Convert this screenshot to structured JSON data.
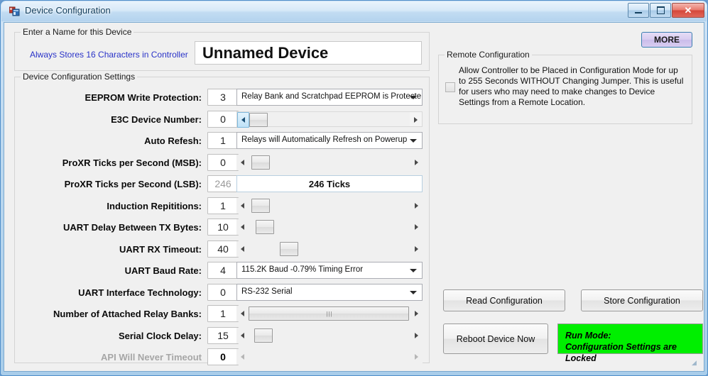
{
  "window": {
    "title": "Device Configuration",
    "icon": "app-icon",
    "buttons": {
      "minimize": "minimize-icon",
      "maximize": "maximize-icon",
      "close": "✕"
    }
  },
  "more_button": {
    "label": "MORE"
  },
  "device_name_group": {
    "title": "Enter a Name for this Device",
    "hint": "Always Stores 16 Characters in Controller",
    "value": "Unnamed Device"
  },
  "settings_group": {
    "title": "Device Configuration Settings",
    "rows": [
      {
        "label": "EEPROM Write Protection:",
        "value": "3",
        "control": "combo",
        "text": "Relay Bank and Scratchpad EEPROM is Protecte",
        "disabled": false
      },
      {
        "label": "E3C Device Number:",
        "value": "0",
        "control": "scroll",
        "thumb_pct": 0,
        "thumb_w": 26,
        "boxed": true,
        "disabled": false
      },
      {
        "label": "Auto Refesh:",
        "value": "1",
        "control": "combo",
        "text": "Relays will Automatically Refresh on Powerup",
        "disabled": false
      },
      {
        "label": "ProXR Ticks per Second (MSB):",
        "value": "0",
        "control": "scroll",
        "thumb_pct": 2,
        "thumb_w": 26,
        "boxed": false,
        "disabled": false
      },
      {
        "label": "ProXR Ticks per Second (LSB):",
        "value": "246",
        "control": "tickbox",
        "text": "246 Ticks",
        "disabled": true
      },
      {
        "label": "Induction Repititions:",
        "value": "1",
        "control": "scroll",
        "thumb_pct": 2,
        "thumb_w": 26,
        "boxed": false,
        "disabled": false
      },
      {
        "label": "UART Delay Between TX Bytes:",
        "value": "10",
        "control": "scroll",
        "thumb_pct": 5,
        "thumb_w": 26,
        "boxed": false,
        "disabled": false
      },
      {
        "label": "UART RX Timeout:",
        "value": "40",
        "control": "scroll",
        "thumb_pct": 22,
        "thumb_w": 26,
        "boxed": false,
        "disabled": false
      },
      {
        "label": "UART Baud Rate:",
        "value": "4",
        "control": "combo",
        "text": "115.2K Baud  -0.79% Timing Error",
        "disabled": false
      },
      {
        "label": "UART Interface Technology:",
        "value": "0",
        "control": "combo",
        "text": "RS-232 Serial",
        "disabled": false
      },
      {
        "label": "Number of Attached Relay Banks:",
        "value": "1",
        "control": "scroll",
        "thumb_pct": 0,
        "thumb_w": 226,
        "boxed": false,
        "disabled": false,
        "grip": "llll"
      },
      {
        "label": "Serial Clock Delay:",
        "value": "15",
        "control": "scroll",
        "thumb_pct": 4,
        "thumb_w": 26,
        "boxed": false,
        "disabled": false
      },
      {
        "label": "API Will Never Timeout",
        "value": "0",
        "control": "scroll",
        "thumb_pct": 0,
        "thumb_w": 0,
        "boxed": false,
        "disabled": true,
        "label_dim": true,
        "value_bold": true
      }
    ]
  },
  "remote_group": {
    "title": "Remote Configuration",
    "checkbox_checked": false,
    "description": "Allow Controller to be Placed in Configuration Mode for up to 255 Seconds WITHOUT Changing Jumper.  This is useful for users who may need to make changes to Device Settings from a Remote Location."
  },
  "actions": {
    "read": "Read Configuration",
    "store": "Store Configuration",
    "reboot": "Reboot Device Now"
  },
  "status": {
    "line1": "Run Mode:",
    "line2": "Configuration Settings are Locked",
    "color": "#00ef00"
  }
}
